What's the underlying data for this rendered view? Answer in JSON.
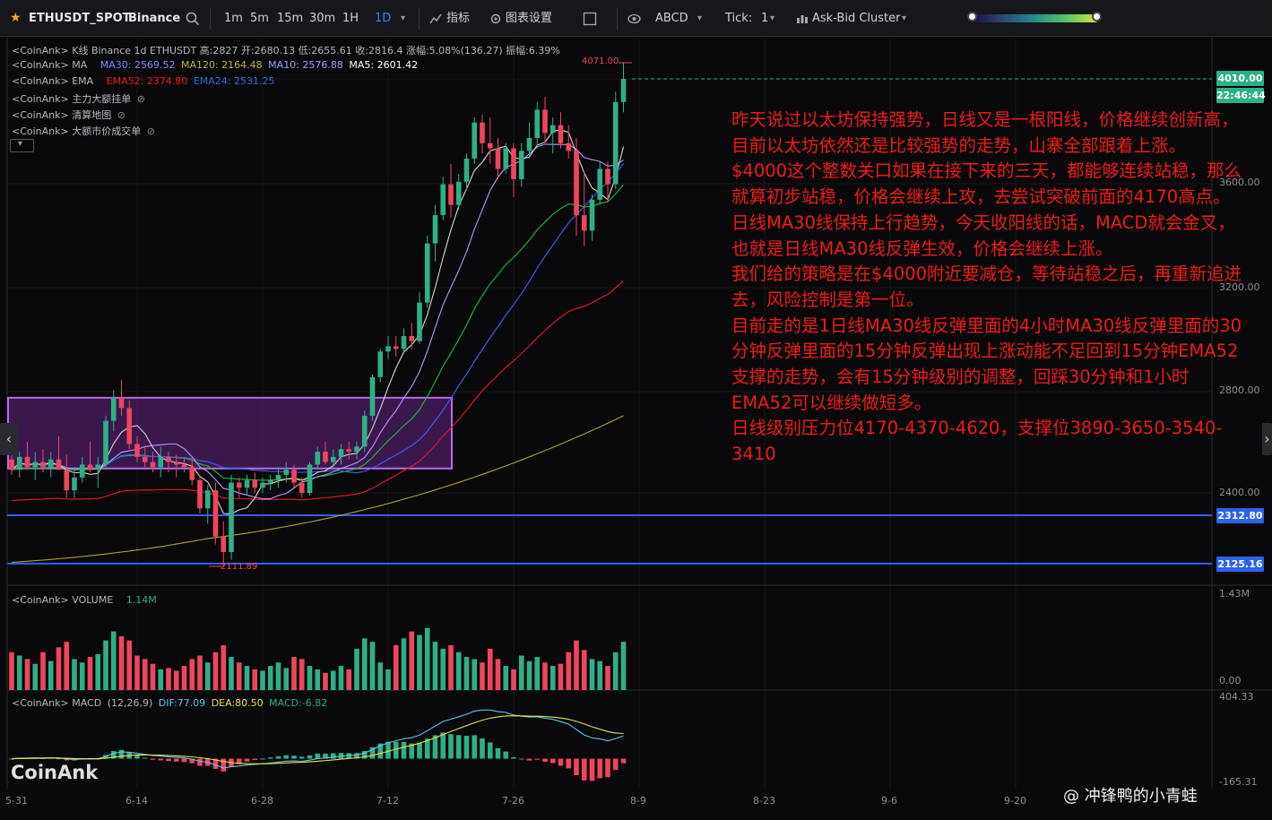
{
  "toolbar": {
    "symbol": "ETHUSDT_SPOT",
    "exchange": "Binance",
    "intervals": [
      "1m",
      "5m",
      "15m",
      "30m",
      "1H",
      "1D"
    ],
    "active_interval": "1D",
    "indicators_label": "指标",
    "chart_settings_label": "图表设置",
    "drawing_label": "ABCD",
    "tick_label": "Tick:",
    "tick_value": "1",
    "cluster_label": "Ask-Bid Cluster",
    "accent_color": "#3d7bff",
    "star_color": "#f5a623"
  },
  "legend": {
    "kline": "<CoinAnk> K线  Binance 1d ETHUSDT 高:2827  开:2680.13  低:2655.61  收:2816.4 涨幅:5.08%(136.27) 振幅:6.39%",
    "ma_prefix": "<CoinAnk> MA",
    "ma30": "MA30: 2569.52",
    "ma120": "MA120: 2164.48",
    "ma10": "MA10: 2576.88",
    "ma5": "MA5: 2601.42",
    "ema_prefix": "<CoinAnk> EMA",
    "ema52": "EMA52: 2374.80",
    "ema24": "EMA24: 2531.25",
    "main_orders": "<CoinAnk> 主力大额挂单",
    "liq_map": "<CoinAnk> 清算地图",
    "big_trades": "<CoinAnk> 大额市价成交单",
    "volume_prefix": "<CoinAnk> VOLUME",
    "volume_value": "1.14M",
    "macd_prefix": "<CoinAnk> MACD",
    "macd_params": "(12,26,9)",
    "dif": "DIF:77.09",
    "dea": "DEA:80.50",
    "macd": "MACD:-6.82"
  },
  "annotation": "昨天说过以太坊保持强势，日线又是一根阳线，价格继续创新高，目前以太坊依然还是比较强势的走势，山寨全部跟着上涨。\n$4000这个整数关口如果在接下来的三天，都能够连续站稳，那么就算初步站稳，价格会继续上攻，去尝试突破前面的4170高点。\n日线MA30线保持上行趋势，今天收阳线的话，MACD就会金叉，也就是日线MA30线反弹生效，价格会继续上涨。\n我们给的策略是在$4000附近要减仓，等待站稳之后，再重新追进去，风险控制是第一位。\n目前走的是1日线MA30线反弹里面的4小时MA30线反弹里面的30分钟反弹里面的15分钟反弹出现上涨动能不足回到15分钟EMA52支撑的走势，会有15分钟级别的调整，回踩30分钟和1小时EMA52可以继续做短多。\n日线级别压力位4170-4370-4620，支撑位3890-3650-3540-3410",
  "price_axis": {
    "ticks": [
      "3600.00",
      "3200.00",
      "2800.00",
      "2400.00"
    ],
    "current_price": "4010.00",
    "countdown": "22:46:44",
    "line_1": "2312.80",
    "line_2": "2125.16",
    "high_mark": "4071.00",
    "low_mark": "2111.89",
    "volume_max": "1.43M",
    "volume_min": "0.00",
    "macd_max": "404.33",
    "macd_min": "-165.31"
  },
  "date_axis": [
    "5-31",
    "6-14",
    "6-28",
    "7-12",
    "7-26",
    "8-9",
    "8-23",
    "9-6",
    "9-20"
  ],
  "colors": {
    "up": "#2eb086",
    "down": "#f0455e",
    "ma5": "#d6d6d6",
    "ma10": "#b896ff",
    "ma30": "#4060ff",
    "ma120": "#b0a040",
    "ema24": "#19c039",
    "ema52": "#e81c1c",
    "level_line": "#2c62f0",
    "box_fill": "#4b1e63",
    "box_border": "#b86be0",
    "annotation": "#f01a1a"
  },
  "watermark": {
    "left": "CoinAnk",
    "right": "@ 冲锋鸭的小青蛙"
  },
  "chart_data": {
    "type": "candlestick",
    "symbol": "ETHUSDT",
    "interval": "1d",
    "x_labels": [
      "5-31",
      "6-14",
      "6-28",
      "7-12",
      "7-26",
      "8-9"
    ],
    "candles_ohlc": [
      [
        2530,
        2580,
        2470,
        2490
      ],
      [
        2490,
        2560,
        2460,
        2540
      ],
      [
        2540,
        2600,
        2490,
        2500
      ],
      [
        2500,
        2560,
        2450,
        2520
      ],
      [
        2520,
        2570,
        2480,
        2500
      ],
      [
        2500,
        2560,
        2460,
        2530
      ],
      [
        2530,
        2620,
        2500,
        2490
      ],
      [
        2490,
        2550,
        2380,
        2410
      ],
      [
        2410,
        2500,
        2380,
        2460
      ],
      [
        2460,
        2540,
        2440,
        2510
      ],
      [
        2510,
        2600,
        2480,
        2490
      ],
      [
        2490,
        2540,
        2420,
        2510
      ],
      [
        2510,
        2700,
        2490,
        2680
      ],
      [
        2680,
        2800,
        2640,
        2770
      ],
      [
        2770,
        2840,
        2700,
        2730
      ],
      [
        2730,
        2760,
        2570,
        2590
      ],
      [
        2590,
        2620,
        2520,
        2540
      ],
      [
        2540,
        2580,
        2490,
        2520
      ],
      [
        2520,
        2560,
        2480,
        2500
      ],
      [
        2500,
        2580,
        2460,
        2540
      ],
      [
        2540,
        2560,
        2480,
        2520
      ],
      [
        2520,
        2550,
        2460,
        2510
      ],
      [
        2510,
        2540,
        2480,
        2500
      ],
      [
        2500,
        2530,
        2430,
        2450
      ],
      [
        2450,
        2470,
        2320,
        2340
      ],
      [
        2340,
        2430,
        2280,
        2410
      ],
      [
        2410,
        2440,
        2200,
        2230
      ],
      [
        2230,
        2290,
        2112,
        2170
      ],
      [
        2170,
        2470,
        2140,
        2440
      ],
      [
        2440,
        2460,
        2380,
        2420
      ],
      [
        2420,
        2470,
        2390,
        2450
      ],
      [
        2450,
        2480,
        2400,
        2420
      ],
      [
        2420,
        2460,
        2400,
        2440
      ],
      [
        2440,
        2470,
        2410,
        2450
      ],
      [
        2450,
        2500,
        2420,
        2470
      ],
      [
        2470,
        2520,
        2440,
        2490
      ],
      [
        2490,
        2510,
        2420,
        2440
      ],
      [
        2440,
        2460,
        2380,
        2400
      ],
      [
        2400,
        2520,
        2390,
        2510
      ],
      [
        2510,
        2580,
        2490,
        2560
      ],
      [
        2560,
        2600,
        2510,
        2520
      ],
      [
        2520,
        2570,
        2500,
        2540
      ],
      [
        2540,
        2590,
        2510,
        2570
      ],
      [
        2570,
        2600,
        2530,
        2560
      ],
      [
        2560,
        2600,
        2530,
        2580
      ],
      [
        2580,
        2720,
        2560,
        2700
      ],
      [
        2700,
        2860,
        2680,
        2850
      ],
      [
        2850,
        2960,
        2830,
        2950
      ],
      [
        2950,
        3010,
        2920,
        2970
      ],
      [
        2970,
        3010,
        2930,
        2960
      ],
      [
        2960,
        3040,
        2940,
        3010
      ],
      [
        3010,
        3060,
        2960,
        2990
      ],
      [
        2990,
        3180,
        2980,
        3140
      ],
      [
        3140,
        3400,
        3120,
        3370
      ],
      [
        3370,
        3520,
        3300,
        3480
      ],
      [
        3480,
        3630,
        3460,
        3600
      ],
      [
        3600,
        3680,
        3470,
        3520
      ],
      [
        3520,
        3640,
        3500,
        3610
      ],
      [
        3610,
        3720,
        3580,
        3700
      ],
      [
        3700,
        3860,
        3680,
        3840
      ],
      [
        3840,
        3870,
        3720,
        3760
      ],
      [
        3760,
        3860,
        3680,
        3740
      ],
      [
        3740,
        3780,
        3620,
        3660
      ],
      [
        3660,
        3760,
        3640,
        3740
      ],
      [
        3740,
        3760,
        3550,
        3620
      ],
      [
        3620,
        3760,
        3590,
        3730
      ],
      [
        3730,
        3840,
        3700,
        3780
      ],
      [
        3780,
        3920,
        3740,
        3890
      ],
      [
        3890,
        3940,
        3760,
        3800
      ],
      [
        3800,
        3860,
        3720,
        3830
      ],
      [
        3830,
        3880,
        3740,
        3760
      ],
      [
        3760,
        3830,
        3700,
        3730
      ],
      [
        3730,
        3780,
        3400,
        3480
      ],
      [
        3480,
        3650,
        3360,
        3420
      ],
      [
        3420,
        3560,
        3380,
        3540
      ],
      [
        3540,
        3690,
        3520,
        3660
      ],
      [
        3660,
        3690,
        3530,
        3600
      ],
      [
        3600,
        3960,
        3580,
        3920
      ],
      [
        3920,
        4071,
        3880,
        4010
      ]
    ],
    "volumes_m": [
      0.55,
      0.5,
      0.45,
      0.38,
      0.55,
      0.42,
      0.62,
      0.7,
      0.45,
      0.4,
      0.48,
      0.52,
      0.72,
      0.85,
      0.78,
      0.72,
      0.5,
      0.45,
      0.38,
      0.3,
      0.32,
      0.28,
      0.35,
      0.45,
      0.5,
      0.4,
      0.55,
      0.65,
      0.48,
      0.4,
      0.35,
      0.3,
      0.28,
      0.35,
      0.4,
      0.32,
      0.48,
      0.45,
      0.35,
      0.3,
      0.25,
      0.28,
      0.35,
      0.3,
      0.6,
      0.75,
      0.7,
      0.4,
      0.3,
      0.65,
      0.75,
      0.85,
      0.8,
      0.9,
      0.7,
      0.6,
      0.65,
      0.55,
      0.48,
      0.45,
      0.4,
      0.6,
      0.45,
      0.35,
      0.3,
      0.5,
      0.42,
      0.48,
      0.4,
      0.35,
      0.38,
      0.55,
      0.72,
      0.58,
      0.45,
      0.42,
      0.35,
      0.55,
      0.7
    ],
    "overlays": [
      "MA5",
      "MA10",
      "MA30",
      "MA120",
      "EMA24",
      "EMA52"
    ],
    "horizontal_levels": [
      2312.8,
      2125.16
    ],
    "consolidation_box": {
      "price_top": 2770,
      "price_bottom": 2495
    },
    "ylim": [
      2050,
      4130
    ],
    "macd_ylim": [
      -165.31,
      404.33
    ],
    "volume_ylim": [
      0,
      1.43
    ]
  }
}
